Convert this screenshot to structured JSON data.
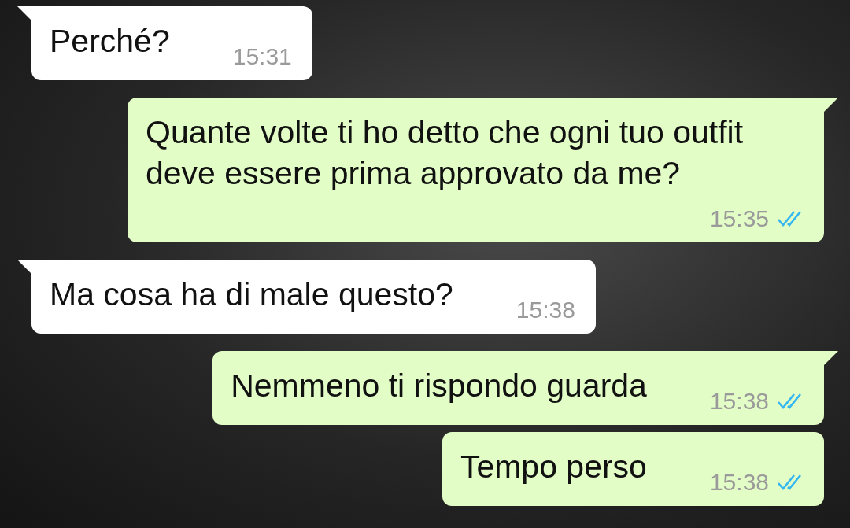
{
  "messages": [
    {
      "kind": "incoming",
      "text": "Perché?",
      "time": "15:31"
    },
    {
      "kind": "outgoing",
      "text": "Quante volte ti ho detto che ogni tuo outfit deve essere prima approvato da me?",
      "time": "15:35",
      "read": true
    },
    {
      "kind": "incoming",
      "text": "Ma cosa ha di male questo?",
      "time": "15:38"
    },
    {
      "kind": "outgoing",
      "text": "Nemmeno ti rispondo guarda",
      "time": "15:38",
      "read": true
    },
    {
      "kind": "outgoing",
      "text": "Tempo perso",
      "time": "15:38",
      "read": true
    }
  ]
}
